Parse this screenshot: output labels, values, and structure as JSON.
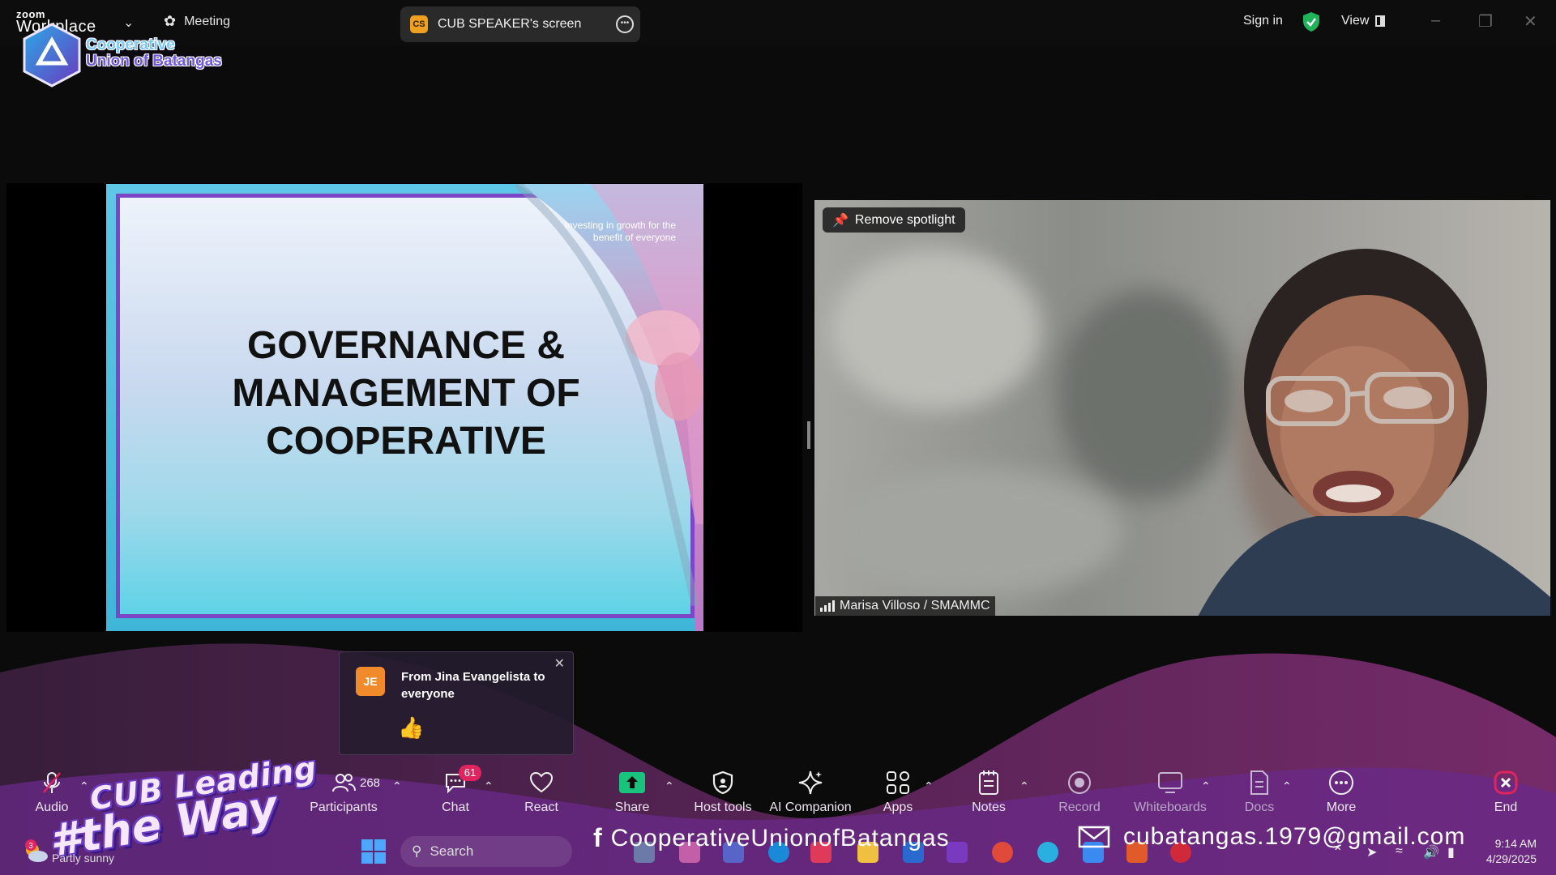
{
  "titlebar": {
    "brand_top": "zoom",
    "brand_bottom": "Workplace",
    "meeting_label": "Meeting",
    "screen_label": "CUB SPEAKER's screen",
    "screen_badge": "CS",
    "sign_in": "Sign in",
    "view_label": "View"
  },
  "logo": {
    "line1": "Cooperative",
    "line2": "Union of Batangas"
  },
  "slide": {
    "title": "GOVERNANCE & MANAGEMENT OF COOPERATIVE",
    "tagline": "Investing in growth for the benefit of everyone"
  },
  "video": {
    "spotlight_button": "Remove spotlight",
    "participant_name": "Marisa Villoso / SMAMMC"
  },
  "notification": {
    "initials": "JE",
    "text": "From Jina Evangelista to everyone",
    "message_emoji": "👍"
  },
  "toolbar": {
    "audio": "Audio",
    "participants": "Participants",
    "participants_count": "268",
    "chat": "Chat",
    "chat_badge": "61",
    "react": "React",
    "share": "Share",
    "host_tools": "Host tools",
    "ai_companion": "AI Companion",
    "apps": "Apps",
    "notes": "Notes",
    "record": "Record",
    "whiteboards": "Whiteboards",
    "docs": "Docs",
    "more": "More",
    "end": "End"
  },
  "overlay": {
    "lead_line1": "CUB Leading",
    "lead_line2": "#the Way",
    "facebook": "CooperativeUnionofBatangas",
    "email": "cubatangas.1979@gmail.com"
  },
  "taskbar": {
    "weather_count": "3",
    "weather_text": "Partly sunny",
    "search_placeholder": "Search",
    "time": "9:14 AM",
    "date": "4/29/2025"
  },
  "colors": {
    "accent_purple": "#7b47c7",
    "shield_green": "#1fb35a",
    "share_green": "#19c37d",
    "end_red": "#e0245e"
  }
}
